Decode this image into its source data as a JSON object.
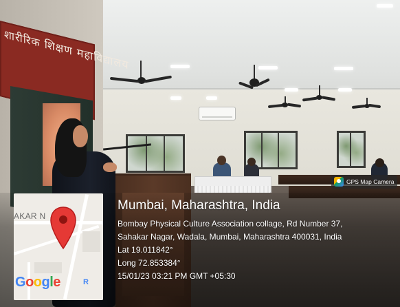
{
  "banner": {
    "text": "शारीरिक शिक्षण महाविद्यालय"
  },
  "badge": {
    "icon": "gps-map-camera-icon",
    "label": "GPS Map Camera"
  },
  "map": {
    "label": "AKAR N",
    "pin_icon": "map-pin-icon",
    "pin_color": "#e53935",
    "google_letters": [
      "G",
      "o",
      "o",
      "g",
      "l",
      "e"
    ],
    "google_suffix": "R"
  },
  "location": {
    "title": "Mumbai, Maharashtra, India",
    "address_line1": "Bombay Physical Culture Association collage, Rd Number 37,",
    "address_line2": "Sahakar Nagar, Wadala, Mumbai, Maharashtra 400031, India",
    "lat": "Lat 19.011842°",
    "long": "Long 72.853384°",
    "timestamp": "15/01/23 03:21 PM GMT +05:30"
  }
}
